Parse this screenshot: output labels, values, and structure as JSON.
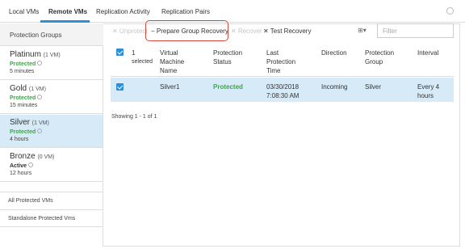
{
  "tabs": [
    {
      "label": "Local VMs"
    },
    {
      "label": "Remote VMs"
    },
    {
      "label": "Replication Activity"
    },
    {
      "label": "Replication Pairs"
    }
  ],
  "sidebar": {
    "header": "Protection Groups",
    "groups": [
      {
        "name": "Platinum",
        "count": "(1 VM)",
        "status": "Protected",
        "interval": "5 minutes"
      },
      {
        "name": "Gold",
        "count": "(1 VM)",
        "status": "Protected",
        "interval": "15 minutes"
      },
      {
        "name": "Silver",
        "count": "(1 VM)",
        "status": "Protected",
        "interval": "4 hours"
      },
      {
        "name": "Bronze",
        "count": "(0 VM)",
        "status": "Active",
        "interval": "12 hours"
      }
    ],
    "links": [
      "All Protected VMs",
      "Standalone Protected Vms"
    ]
  },
  "toolbar": {
    "unprotect": "✕ Unprotect",
    "prepare": "− Prepare Group Recovery",
    "recover": "✕ Recover",
    "test": "✕ Test Recovery",
    "filter_placeholder": "Filter"
  },
  "table": {
    "selected_count": "1",
    "selected_label": "selected",
    "headers": [
      "Virtual Machine Name",
      "Protection Status",
      "Last Protection Time",
      "Direction",
      "Protection Group",
      "Interval"
    ],
    "rows": [
      {
        "vm": "Silver1",
        "status": "Protected",
        "time": "03/30/2018 7:08:30 AM",
        "direction": "Incoming",
        "group": "Silver",
        "interval": "Every 4 hours"
      }
    ],
    "footer": "Showing 1 - 1 of 1"
  },
  "colors": {
    "accent": "#2d8fd7",
    "protected": "#3fa54a",
    "highlight": "#d8483a",
    "selected_row": "#d7eaf8"
  }
}
